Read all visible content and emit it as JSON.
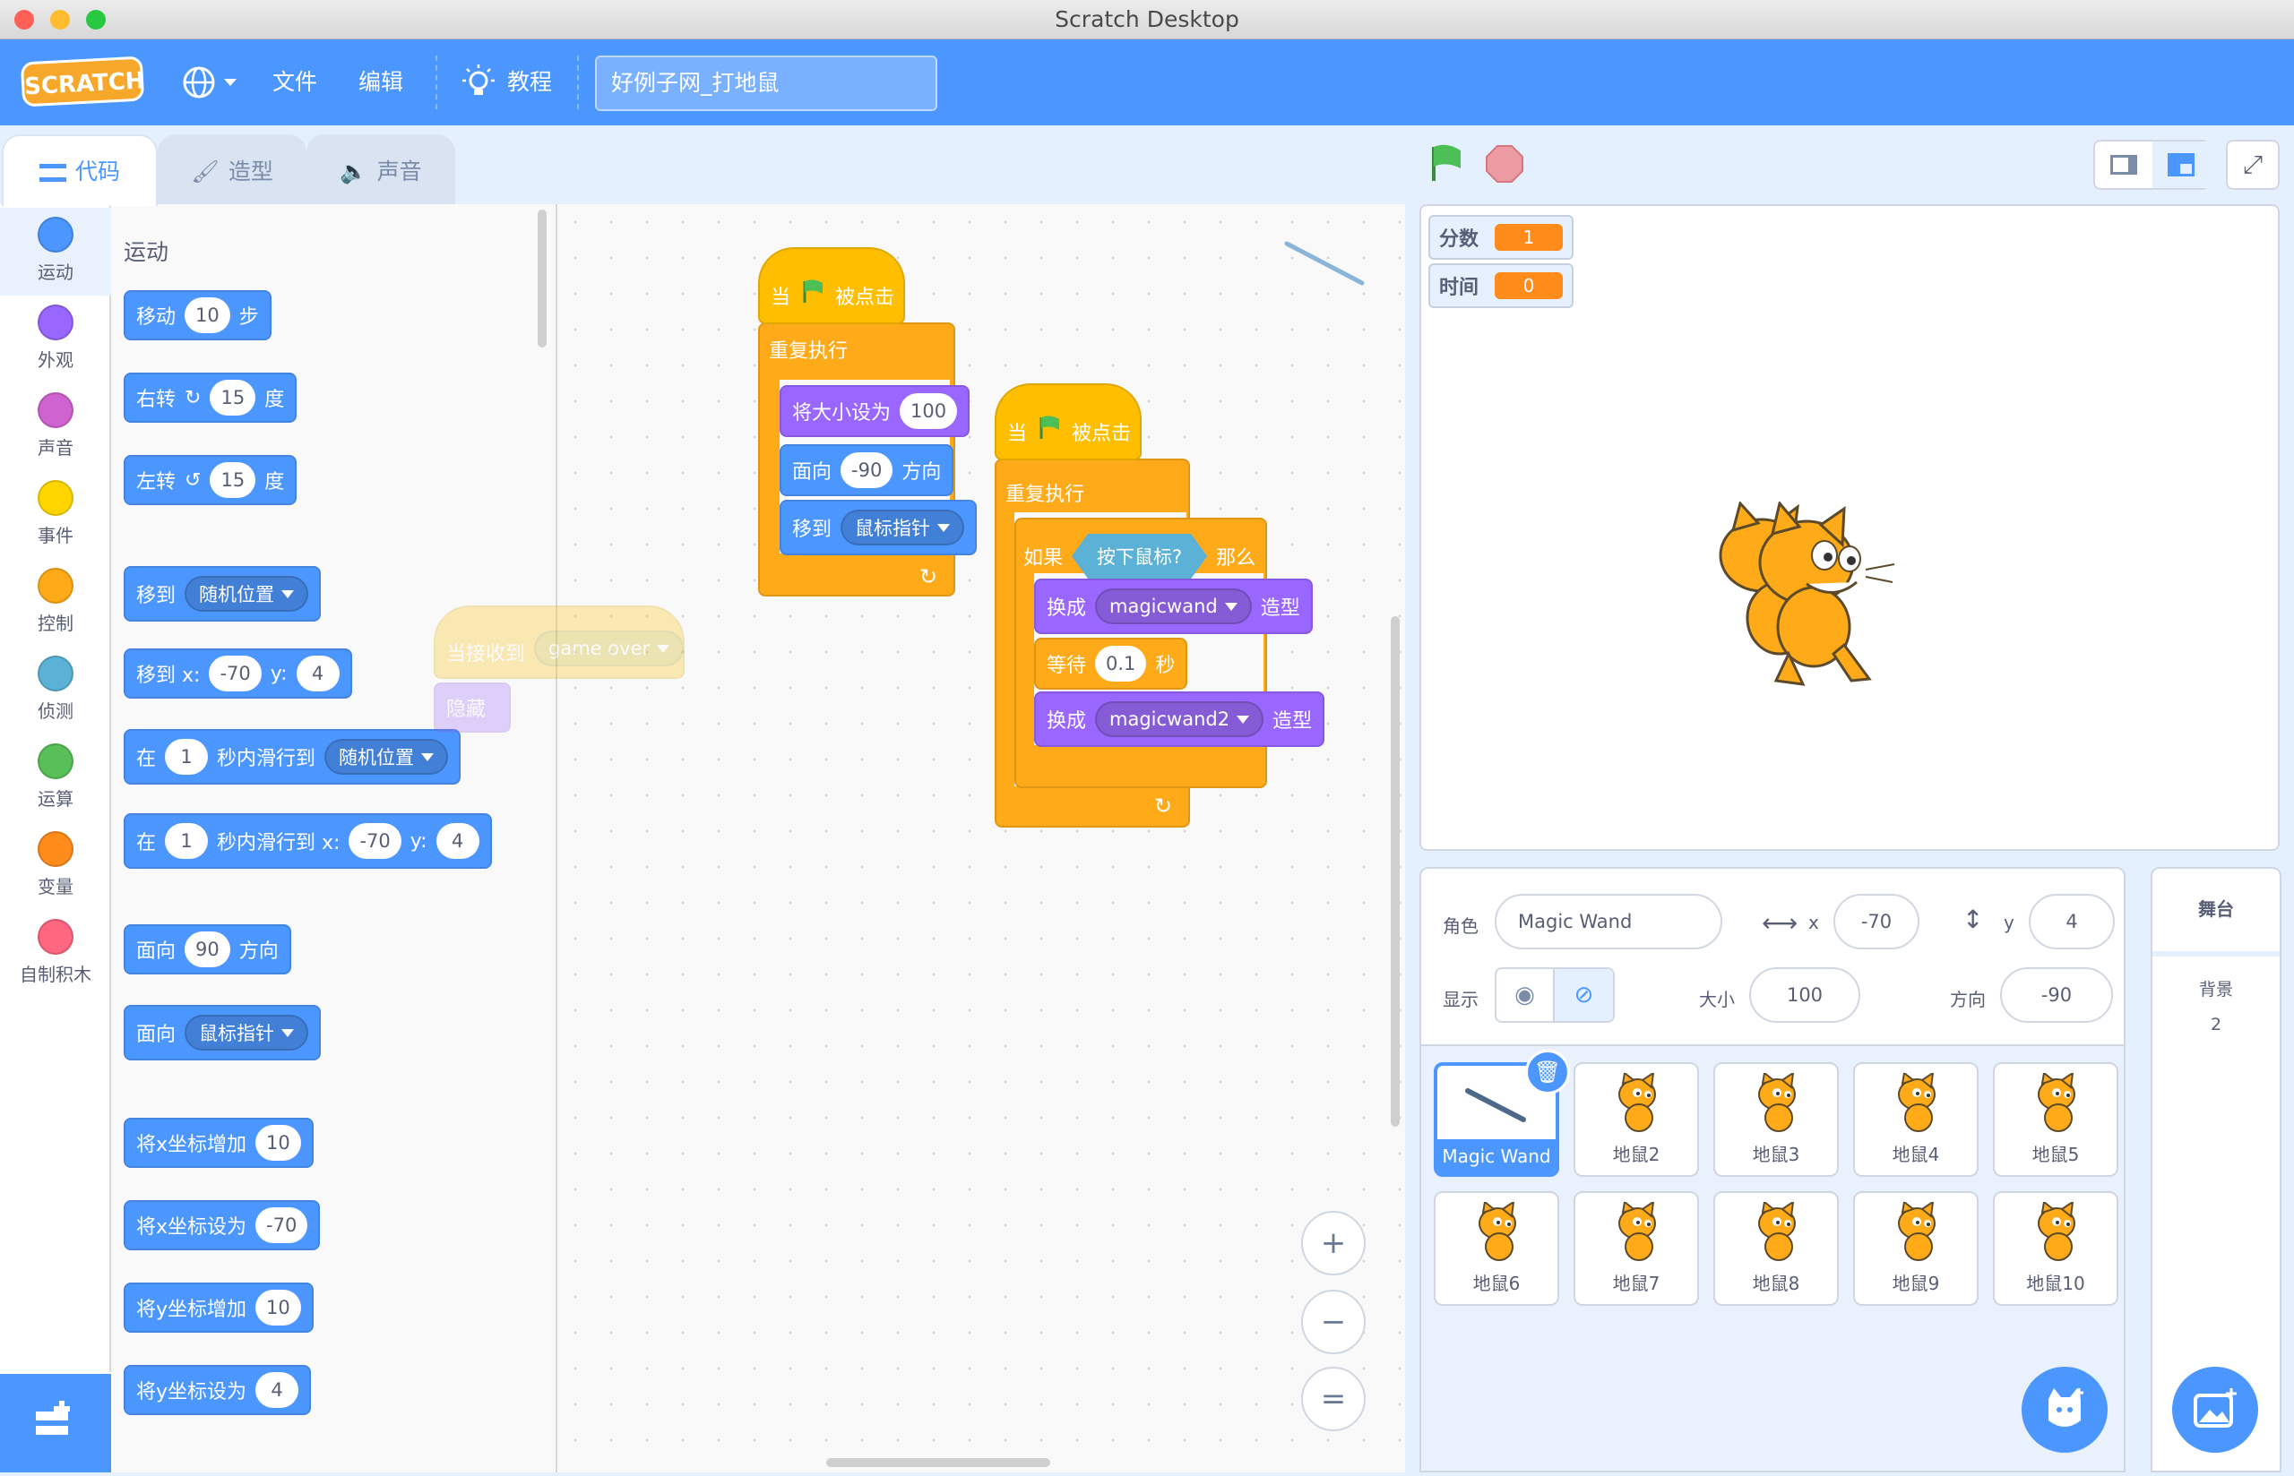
{
  "window": {
    "title": "Scratch Desktop"
  },
  "menubar": {
    "logo": "SCRATCH",
    "file": "文件",
    "edit": "编辑",
    "tutorials": "教程",
    "project_title": "好例子网_打地鼠"
  },
  "tabs": [
    {
      "label": "代码",
      "active": true
    },
    {
      "label": "造型",
      "active": false
    },
    {
      "label": "声音",
      "active": false
    }
  ],
  "categories": [
    {
      "label": "运动",
      "color": "#4c97ff"
    },
    {
      "label": "外观",
      "color": "#9966ff"
    },
    {
      "label": "声音",
      "color": "#cf63cf"
    },
    {
      "label": "事件",
      "color": "#ffd500"
    },
    {
      "label": "控制",
      "color": "#ffab19"
    },
    {
      "label": "侦测",
      "color": "#5cb1d6"
    },
    {
      "label": "运算",
      "color": "#59c059"
    },
    {
      "label": "变量",
      "color": "#ff8c1a"
    },
    {
      "label": "自制积木",
      "color": "#ff6680"
    }
  ],
  "palette": {
    "heading": "运动",
    "move": {
      "a": "移动",
      "v": "10",
      "b": "步"
    },
    "turn_right": {
      "a": "右转",
      "v": "15",
      "b": "度"
    },
    "turn_left": {
      "a": "左转",
      "v": "15",
      "b": "度"
    },
    "goto": {
      "a": "移到",
      "dd": "随机位置"
    },
    "goto_xy": {
      "a": "移到 x:",
      "x": "-70",
      "y_label": "y:",
      "y": "4"
    },
    "glide": {
      "a": "在",
      "v": "1",
      "b": "秒内滑行到",
      "dd": "随机位置"
    },
    "glide_xy": {
      "a": "在",
      "v": "1",
      "b": "秒内滑行到 x:",
      "x": "-70",
      "y_label": "y:",
      "y": "4"
    },
    "point_dir": {
      "a": "面向",
      "v": "90",
      "b": "方向"
    },
    "point_towards": {
      "a": "面向",
      "dd": "鼠标指针"
    },
    "change_x": {
      "a": "将x坐标增加",
      "v": "10"
    },
    "set_x": {
      "a": "将x坐标设为",
      "v": "-70"
    },
    "change_y": {
      "a": "将y坐标增加",
      "v": "10"
    },
    "set_y": {
      "a": "将y坐标设为",
      "v": "4"
    }
  },
  "script1": {
    "hat_a": "当",
    "hat_b": "被点击",
    "forever": "重复执行",
    "size": {
      "a": "将大小设为",
      "v": "100"
    },
    "dir": {
      "a": "面向",
      "v": "-90",
      "b": "方向"
    },
    "goto": {
      "a": "移到",
      "dd": "鼠标指针"
    }
  },
  "ghost": {
    "a": "当接收到",
    "dd": "game over",
    "b": "隐藏"
  },
  "script2": {
    "hat_a": "当",
    "hat_b": "被点击",
    "forever": "重复执行",
    "if_a": "如果",
    "cond": "按下鼠标?",
    "if_b": "那么",
    "sw1": {
      "a": "换成",
      "dd": "magicwand",
      "b": "造型"
    },
    "wait": {
      "a": "等待",
      "v": "0.1",
      "b": "秒"
    },
    "sw2": {
      "a": "换成",
      "dd": "magicwand2",
      "b": "造型"
    }
  },
  "zoom": {
    "in": "+",
    "out": "−",
    "reset": "="
  },
  "stage": {
    "monitors": [
      {
        "label": "分数",
        "value": "1"
      },
      {
        "label": "时间",
        "value": "0"
      }
    ]
  },
  "sprite_info": {
    "sprite_label": "角色",
    "sprite_name": "Magic Wand",
    "x_label": "x",
    "x": "-70",
    "y_label": "y",
    "y": "4",
    "show_label": "显示",
    "size_label": "大小",
    "size": "100",
    "dir_label": "方向",
    "dir": "-90"
  },
  "sprites": [
    "Magic Wand",
    "地鼠2",
    "地鼠3",
    "地鼠4",
    "地鼠5",
    "地鼠6",
    "地鼠7",
    "地鼠8",
    "地鼠9",
    "地鼠10"
  ],
  "stage_panel": {
    "title": "舞台",
    "backdrop_label": "背景",
    "backdrop_count": "2"
  }
}
